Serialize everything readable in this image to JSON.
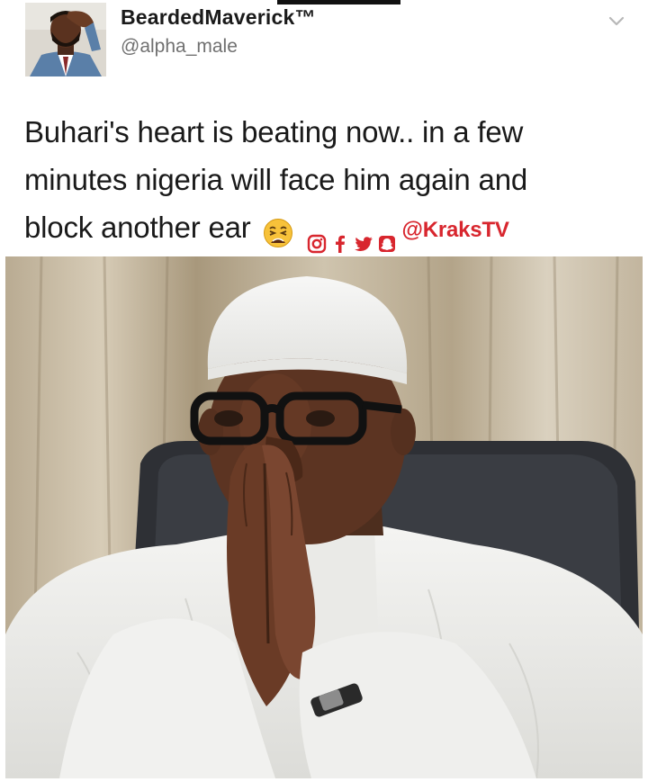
{
  "tweet": {
    "display_name": "BeardedMaverick™",
    "handle": "@alpha_male",
    "text_lines": [
      "Buhari's heart is beating now.. in a few",
      "minutes nigeria will face him again and",
      "block another ear"
    ],
    "watermark_handle": "@KraksTV"
  },
  "icons": {
    "avatar": "avatar-photo",
    "menu": "chevron-down-icon",
    "emoji": "weary-face-emoji",
    "social": [
      "instagram-icon",
      "facebook-icon",
      "twitter-icon",
      "snapchat-icon"
    ]
  },
  "colors": {
    "accent_red": "#d8262e",
    "text": "#1a1a1a",
    "handle_gray": "#707070"
  }
}
